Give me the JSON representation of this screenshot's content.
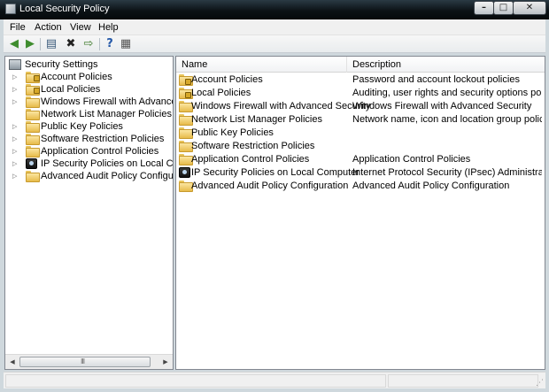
{
  "window": {
    "title": "Local Security Policy"
  },
  "caption_buttons": {
    "minimize": "–",
    "maximize": "□",
    "close": "✕"
  },
  "menu": [
    {
      "label": "File"
    },
    {
      "label": "Action"
    },
    {
      "label": "View"
    },
    {
      "label": "Help"
    }
  ],
  "toolbar": [
    "back-icon",
    "forward-icon",
    "show-hide-tree-icon",
    "delete-icon",
    "export-list-icon",
    "help-icon",
    "properties-icon"
  ],
  "tree": {
    "root": "Security Settings",
    "items": [
      {
        "label": "Account Policies",
        "icon": "folder-lock"
      },
      {
        "label": "Local Policies",
        "icon": "folder-lock"
      },
      {
        "label": "Windows Firewall with Advanced Security",
        "icon": "folder"
      },
      {
        "label": "Network List Manager Policies",
        "icon": "folder"
      },
      {
        "label": "Public Key Policies",
        "icon": "folder"
      },
      {
        "label": "Software Restriction Policies",
        "icon": "folder"
      },
      {
        "label": "Application Control Policies",
        "icon": "folder"
      },
      {
        "label": "IP Security Policies on Local Computer",
        "icon": "ipsec"
      },
      {
        "label": "Advanced Audit Policy Configuration",
        "icon": "folder"
      }
    ]
  },
  "scrollbar": {
    "grip": "III"
  },
  "list": {
    "columns": [
      "Name",
      "Description"
    ],
    "rows": [
      {
        "name": "Account Policies",
        "description": "Password and account lockout policies",
        "icon": "folder-lock"
      },
      {
        "name": "Local Policies",
        "description": "Auditing, user rights and security options polici...",
        "icon": "folder-lock"
      },
      {
        "name": "Windows Firewall with Advanced Security",
        "description": "Windows Firewall with Advanced Security",
        "icon": "folder"
      },
      {
        "name": "Network List Manager Policies",
        "description": "Network name, icon and location group policies.",
        "icon": "folder"
      },
      {
        "name": "Public Key Policies",
        "description": "",
        "icon": "folder"
      },
      {
        "name": "Software Restriction Policies",
        "description": "",
        "icon": "folder"
      },
      {
        "name": "Application Control Policies",
        "description": "Application Control Policies",
        "icon": "folder"
      },
      {
        "name": "IP Security Policies on Local Computer",
        "description": "Internet Protocol Security (IPsec) Administratio...",
        "icon": "ipsec"
      },
      {
        "name": "Advanced Audit Policy Configuration",
        "description": "Advanced Audit Policy Configuration",
        "icon": "folder"
      }
    ]
  },
  "colors": {
    "accent": "#0c1216",
    "pane_border": "#828790",
    "folder": "#e7bb4a"
  }
}
